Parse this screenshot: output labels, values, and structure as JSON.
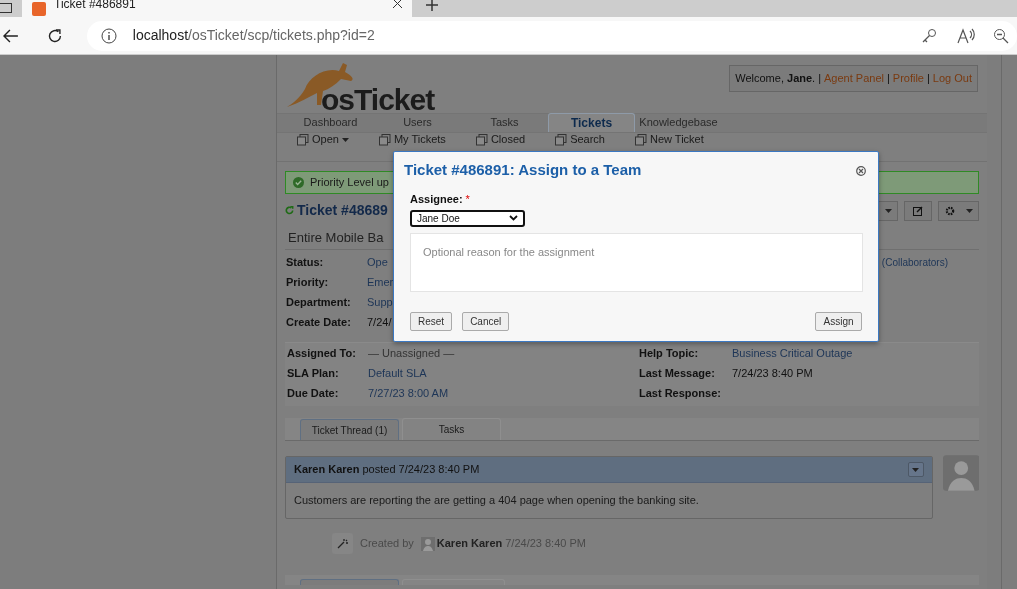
{
  "browser": {
    "tab_title": "Ticket #486891",
    "url_host": "localhost",
    "url_path": "/osTicket/scp/tickets.php?id=2"
  },
  "header": {
    "logo_text": "osTicket",
    "welcome": "Welcome, **Jane**.",
    "separator": "|",
    "links": [
      "Agent Panel",
      "Profile",
      "Log Out"
    ]
  },
  "nav": [
    {
      "label": "Dashboard",
      "selected": false
    },
    {
      "label": "Users",
      "selected": false
    },
    {
      "label": "Tasks",
      "selected": false
    },
    {
      "label": "Tickets",
      "selected": true
    },
    {
      "label": "Knowledgebase",
      "selected": false
    }
  ],
  "subnav": [
    {
      "label": "Open",
      "dropdown": true
    },
    {
      "label": "My Tickets",
      "dropdown": false
    },
    {
      "label": "Closed",
      "dropdown": false
    },
    {
      "label": "Search",
      "dropdown": false
    },
    {
      "label": "New Ticket",
      "dropdown": false
    }
  ],
  "alert": {
    "text": "Priority Level up"
  },
  "ticket": {
    "title": "Ticket #48689",
    "subject": "Entire Mobile Ba",
    "collaborators": "(Collaborators)",
    "fields": [
      {
        "label": "Status:",
        "value": "Ope",
        "kind": "link"
      },
      {
        "label": "Priority:",
        "value": "Emer",
        "kind": "link"
      },
      {
        "label": "Department:",
        "value": "Supp",
        "kind": "link"
      },
      {
        "label": "Create Date:",
        "value": "7/24/",
        "kind": "text"
      }
    ],
    "details_left": [
      {
        "label": "Assigned To:",
        "value": "— Unassigned —",
        "kind": "muted"
      },
      {
        "label": "SLA Plan:",
        "value": "Default SLA",
        "kind": "link"
      },
      {
        "label": "Due Date:",
        "value": "7/27/23 8:00 AM",
        "kind": "link"
      }
    ],
    "details_right": [
      {
        "label": "Help Topic:",
        "value": "Business Critical Outage",
        "kind": "link"
      },
      {
        "label": "Last Message:",
        "value": "7/24/23 8:40 PM",
        "kind": "text"
      },
      {
        "label": "Last Response:"
      }
    ]
  },
  "thread_tabs": [
    {
      "label": "Ticket Thread (1)",
      "selected": true
    },
    {
      "label": "Tasks",
      "selected": false
    }
  ],
  "entry": {
    "author": "Karen Karen",
    "verb": "posted",
    "time": "7/24/23 8:40 PM",
    "body": "Customers are reporting the are getting a 404 page when opening the banking site."
  },
  "event": {
    "prefix": "Created by",
    "author": "Karen Karen",
    "time": "7/24/23 8:40 PM"
  },
  "modal": {
    "title": "Ticket #486891: Assign to a Team",
    "field_label": "Assignee:",
    "required_mark": "*",
    "select_value": "Jane Doe",
    "placeholder": "Optional reason for the assignment",
    "buttons": [
      "Reset",
      "Cancel",
      "Assign"
    ]
  }
}
